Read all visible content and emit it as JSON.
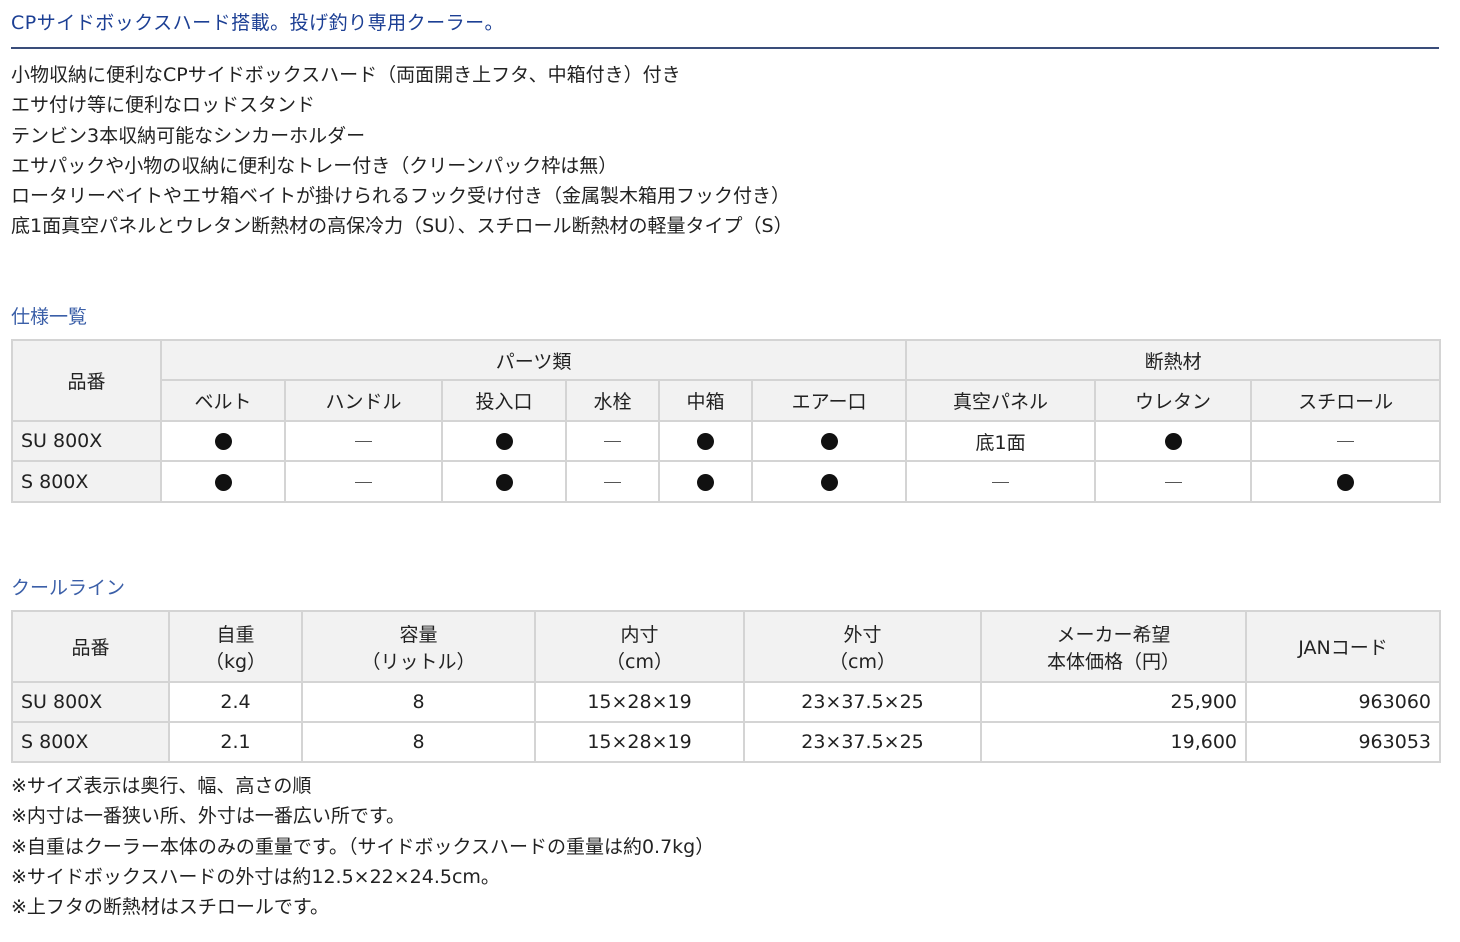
{
  "heading": "CPサイドボックスハード搭載。投げ釣り専用クーラー。",
  "features": [
    "小物収納に便利なCPサイドボックスハード（両面開き上フタ、中箱付き）付き",
    "エサ付け等に便利なロッドスタンド",
    "テンビン3本収納可能なシンカーホルダー",
    "エサパックや小物の収納に便利なトレー付き（クリーンパック枠は無）",
    "ロータリーベイトやエサ箱ベイトが掛けられるフック受け付き（金属製木箱用フック付き）",
    "底1面真空パネルとウレタン断熱材の高保冷力（SU）、スチロール断熱材の軽量タイプ（S）"
  ],
  "spec_section": {
    "title": "仕様一覧",
    "model_header": "品番",
    "group_parts": "パーツ類",
    "group_insulation": "断熱材",
    "columns": [
      "ベルト",
      "ハンドル",
      "投入口",
      "水栓",
      "中箱",
      "エアー口",
      "真空パネル",
      "ウレタン",
      "スチロール"
    ],
    "rows": [
      {
        "model": "SU 800X",
        "cells": [
          "dot",
          "dash",
          "dot",
          "dash",
          "dot",
          "dot",
          "底1面",
          "dot",
          "dash"
        ]
      },
      {
        "model": "S 800X",
        "cells": [
          "dot",
          "dash",
          "dot",
          "dash",
          "dot",
          "dot",
          "dash",
          "dash",
          "dot"
        ]
      }
    ]
  },
  "cool_section": {
    "title": "クールライン",
    "headers": [
      {
        "line1": "品番",
        "line2": ""
      },
      {
        "line1": "自重",
        "line2": "（kg）"
      },
      {
        "line1": "容量",
        "line2": "（リットル）"
      },
      {
        "line1": "内寸",
        "line2": "（cm）"
      },
      {
        "line1": "外寸",
        "line2": "（cm）"
      },
      {
        "line1": "メーカー希望",
        "line2": "本体価格（円）"
      },
      {
        "line1": "JANコード",
        "line2": ""
      }
    ],
    "rows": [
      {
        "model": "SU 800X",
        "weight": "2.4",
        "capacity": "8",
        "inner": "15×28×19",
        "outer": "23×37.5×25",
        "price": "25,900",
        "jan": "963060"
      },
      {
        "model": "S 800X",
        "weight": "2.1",
        "capacity": "8",
        "inner": "15×28×19",
        "outer": "23×37.5×25",
        "price": "19,600",
        "jan": "963053"
      }
    ]
  },
  "notes": [
    "※サイズ表示は奥行、幅、高さの順",
    "※内寸は一番狭い所、外寸は一番広い所です。",
    "※自重はクーラー本体のみの重量です。（サイドボックスハードの重量は約0.7kg）",
    "※サイドボックスハードの外寸は約12.5×22×24.5cm。",
    "※上フタの断熱材はスチロールです。"
  ],
  "colors": {
    "heading": "#1c3f94",
    "section_title": "#3b5fa8",
    "header_bg": "#f2f2f2",
    "border": "#d4d4d4"
  }
}
